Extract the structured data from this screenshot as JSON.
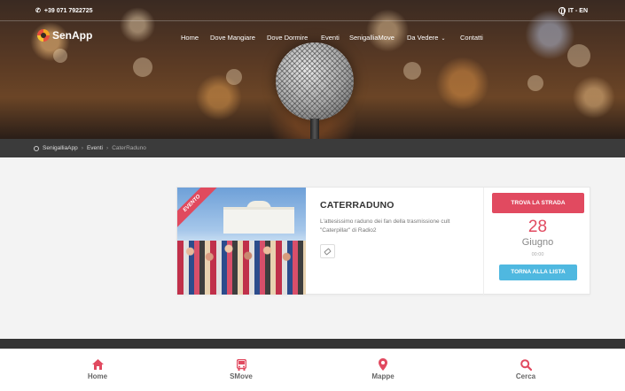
{
  "topbar": {
    "phone": "+39 071 7922725",
    "lang": "IT - EN"
  },
  "brand": {
    "name": "SenApp",
    "accent": "#e14a60"
  },
  "nav": [
    {
      "label": "Home"
    },
    {
      "label": "Dove Mangiare"
    },
    {
      "label": "Dove Dormire"
    },
    {
      "label": "Eventi"
    },
    {
      "label": "SenigalliaMove"
    },
    {
      "label": "Da Vedere"
    },
    {
      "label": "Contatti"
    }
  ],
  "breadcrumb": {
    "items": [
      "SenigalliaApp",
      "Eventi",
      "CaterRaduno"
    ]
  },
  "event": {
    "ribbon": "EVENTO",
    "title": "CATERRADUNO",
    "description": "L'attesissimo raduno dei fan della trasmissione cult \"Caterpillar\" di Radio2",
    "route_button": "TROVA LA STRADA",
    "day": "28",
    "month": "Giugno",
    "time": "00:00",
    "back_button": "TORNA ALLA LISTA"
  },
  "bottom_nav": [
    {
      "label": "Home",
      "icon": "home-icon"
    },
    {
      "label": "SMove",
      "icon": "bus-icon"
    },
    {
      "label": "Mappe",
      "icon": "map-pin-icon"
    },
    {
      "label": "Cerca",
      "icon": "search-icon"
    }
  ],
  "colors": {
    "primary": "#e14a60",
    "secondary": "#4fb8e0",
    "dark": "#3b3b3b"
  }
}
